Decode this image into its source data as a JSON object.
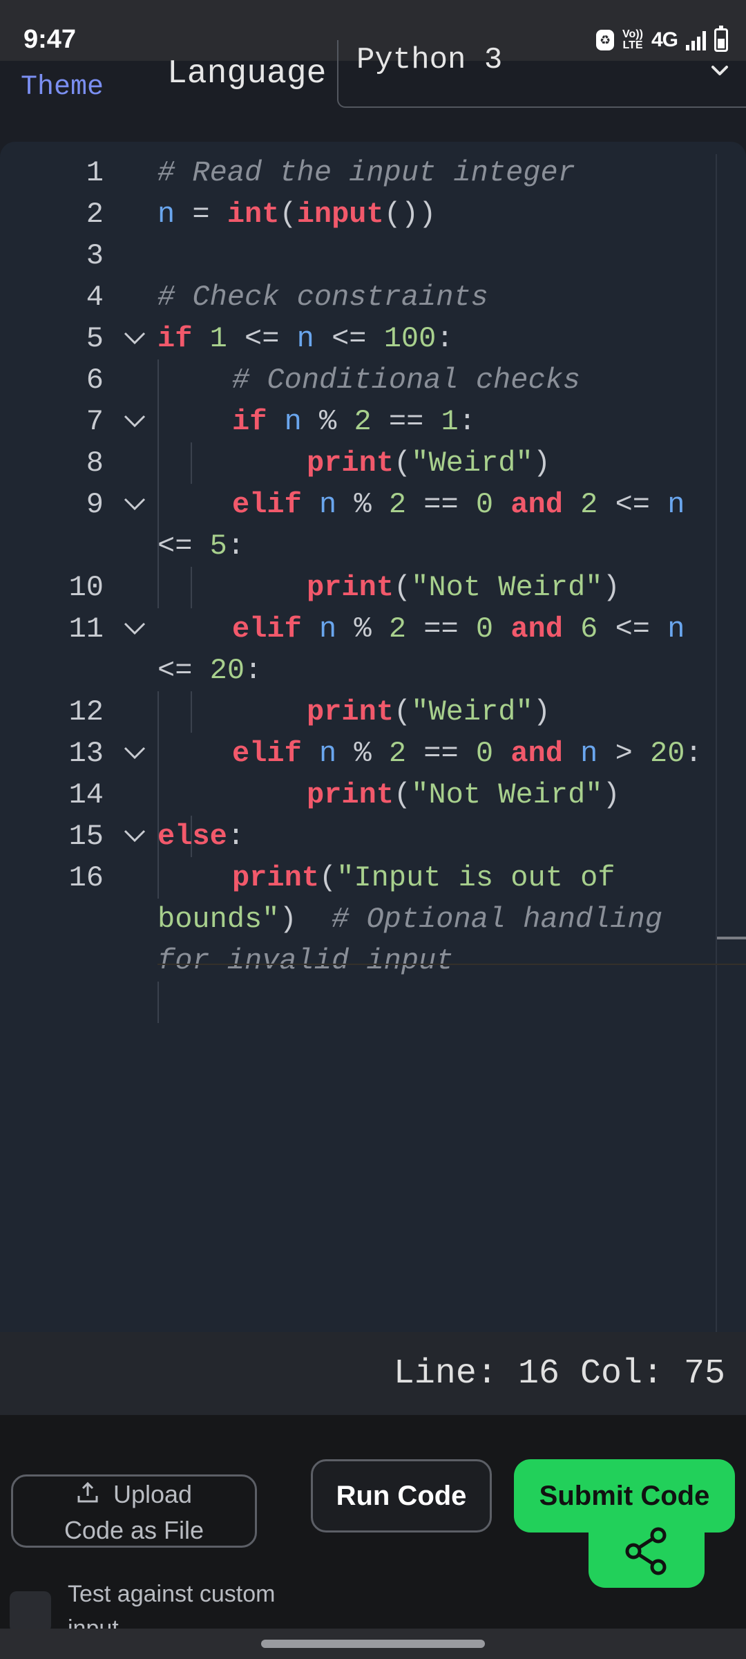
{
  "status_bar": {
    "time": "9:47",
    "volte_line1": "Vo))",
    "volte_line2": "LTE",
    "network": "4G",
    "icons": [
      "recycle-icon",
      "volte-icon",
      "signal-icon",
      "battery-icon"
    ]
  },
  "settings": {
    "theme_label": "Theme",
    "language_label": "Language",
    "language_value": "Python 3"
  },
  "editor": {
    "lines": [
      {
        "n": "1"
      },
      {
        "n": "2"
      },
      {
        "n": "3"
      },
      {
        "n": "4"
      },
      {
        "n": "5"
      },
      {
        "n": "6"
      },
      {
        "n": "7"
      },
      {
        "n": "8"
      },
      {
        "n": "9"
      },
      {
        "n": "10"
      },
      {
        "n": "11"
      },
      {
        "n": "12"
      },
      {
        "n": "13"
      },
      {
        "n": "14"
      },
      {
        "n": "15"
      },
      {
        "n": "16"
      }
    ],
    "code": {
      "l1": "# Read the input integer",
      "l2_var": "n",
      "l2_eq": " = ",
      "l2_int": "int",
      "l2_p1": "(",
      "l2_input": "input",
      "l2_p2": "())",
      "l4": "# Check constraints",
      "l5_if": "if",
      "l5_a": " 1 ",
      "l5_b": "<= ",
      "l5_n": "n",
      "l5_c": " <= ",
      "l5_d": "100",
      "l5_e": ":",
      "l6": "# Conditional checks",
      "l7_if": "if",
      "l7_n": " n",
      "l7_a": " % ",
      "l7_b": "2",
      "l7_c": " == ",
      "l7_d": "1",
      "l7_e": ":",
      "l8_print": "print",
      "l8_a": "(",
      "l8_s": "\"Weird\"",
      "l8_b": ")",
      "l9_elif": "elif",
      "l9_n": " n",
      "l9_a": " % ",
      "l9_b": "2",
      "l9_c": " == ",
      "l9_d": "0",
      "l9_and": " and",
      "l9_e": " 2",
      "l9_f": " <= ",
      "l9_n2": "n",
      "l9w_a": "<= ",
      "l9w_b": "5",
      "l9w_c": ":",
      "l10_print": "print",
      "l10_a": "(",
      "l10_s": "\"Not Weird\"",
      "l10_b": ")",
      "l11_elif": "elif",
      "l11_n": " n",
      "l11_a": " % ",
      "l11_b": "2",
      "l11_c": " == ",
      "l11_d": "0",
      "l11_and": " and",
      "l11_e": " 6",
      "l11_f": " <= ",
      "l11_n2": "n",
      "l11w_a": "<= ",
      "l11w_b": "20",
      "l11w_c": ":",
      "l12_print": "print",
      "l12_a": "(",
      "l12_s": "\"Weird\"",
      "l12_b": ")",
      "l13_elif": "elif",
      "l13_n": " n",
      "l13_a": " % ",
      "l13_b": "2",
      "l13_c": " == ",
      "l13_d": "0",
      "l13_and": " and",
      "l13_n2": " n",
      "l13_e": " > ",
      "l13_f": "20",
      "l13_g": ":",
      "l14_print": "print",
      "l14_a": "(",
      "l14_s": "\"Not Weird\"",
      "l14_b": ")",
      "l15_else": "else",
      "l15_a": ":",
      "l16_print": "print",
      "l16_a": "(",
      "l16_s": "\"Input is out of",
      "l16w_s": "bounds\"",
      "l16w_a": ")  ",
      "l16w_c": "# Optional handling",
      "l16w2_c": "for invalid input"
    }
  },
  "cursor_status": "Line: 16 Col: 75",
  "actions": {
    "upload_line1": "Upload",
    "upload_line2": "Code as File",
    "run": "Run Code",
    "submit": "Submit Code",
    "custom_input_label": "Test against custom",
    "custom_input_label2": "input"
  },
  "colors": {
    "keyword": "#f2596b",
    "variable": "#6aa6ee",
    "string": "#a8d08d",
    "comment": "#8a8f98",
    "submit": "#22d05a"
  }
}
